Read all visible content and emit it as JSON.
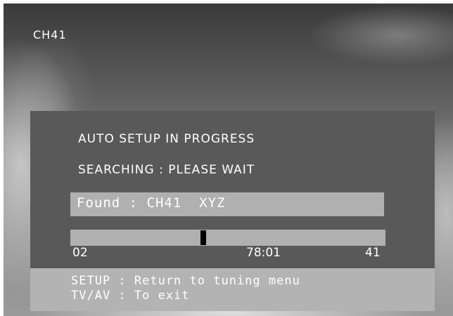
{
  "channel_indicator": "CH41",
  "auto_setup": {
    "heading": "AUTO SETUP IN PROGRESS",
    "status": "SEARCHING : PLEASE WAIT",
    "found_text": "Found : CH41  XYZ",
    "progress": {
      "start_label": "02",
      "middle_label": "78:01",
      "end_label": "41",
      "position_fraction": 0.42
    },
    "help": [
      "SETUP : Return to tuning menu",
      "TV/AV : To exit"
    ]
  },
  "colors": {
    "panel": "#595959",
    "bar": "#b0b0b0",
    "text": "#ffffff",
    "marker": "#000000"
  }
}
